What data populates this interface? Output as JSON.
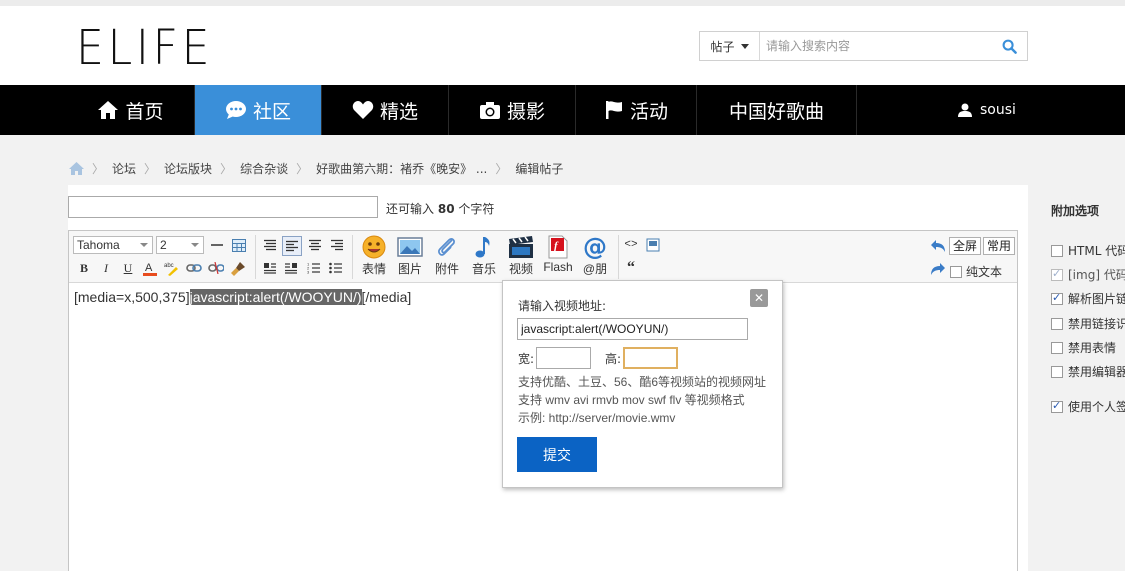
{
  "header": {
    "logo": "ELIFE",
    "search_type": "帖子",
    "search_placeholder": "请输入搜索内容"
  },
  "nav": {
    "items": [
      {
        "label": "首页",
        "icon": "home-icon"
      },
      {
        "label": "社区",
        "icon": "chat-icon",
        "active": true
      },
      {
        "label": "精选",
        "icon": "heart-icon"
      },
      {
        "label": "摄影",
        "icon": "camera-icon"
      },
      {
        "label": "活动",
        "icon": "flag-icon"
      },
      {
        "label": "中国好歌曲",
        "icon": ""
      }
    ],
    "user": "sousi"
  },
  "breadcrumb": [
    "论坛",
    "论坛版块",
    "综合杂谈",
    "好歌曲第六期：褚乔《晚安》 ...",
    "编辑帖子"
  ],
  "title_field": {
    "value": "",
    "hint_prefix": "还可输入",
    "hint_count": "80",
    "hint_suffix": "个字符"
  },
  "toolbar": {
    "font_family": "Tahoma",
    "font_size": "2",
    "bold": "B",
    "italic": "I",
    "underline": "U",
    "quote_glyph": "“",
    "code_glyph": "<>",
    "media": [
      {
        "label": "表情",
        "icon": "smiley-icon"
      },
      {
        "label": "图片",
        "icon": "image-icon"
      },
      {
        "label": "附件",
        "icon": "paperclip-icon"
      },
      {
        "label": "音乐",
        "icon": "music-note-icon"
      },
      {
        "label": "视频",
        "icon": "video-clapper-icon"
      },
      {
        "label": "Flash",
        "icon": "flash-icon"
      },
      {
        "label": "@朋",
        "icon": "at-icon"
      }
    ],
    "fullscreen": "全屏",
    "common": "常用",
    "plain_text": "纯文本"
  },
  "editor": {
    "before": "[media=x,500,375]",
    "selected": "javascript:alert(/WOOYUN/)",
    "after": "[/media]"
  },
  "video_dialog": {
    "title": "请输入视频地址:",
    "url_value": "javascript:alert(/WOOYUN/)",
    "width_label": "宽:",
    "height_label": "高:",
    "width_value": "",
    "height_value": "",
    "notes": [
      "支持优酷、土豆、56、酷6等视频站的视频网址",
      "支持 wmv avi rmvb mov swf flv 等视频格式",
      "示例: http://server/movie.wmv"
    ],
    "submit": "提交"
  },
  "options": {
    "title": "附加选项",
    "items": [
      {
        "label": "HTML 代码",
        "checked": false,
        "disabled": false
      },
      {
        "label": "[img] 代码",
        "checked": true,
        "disabled": true
      },
      {
        "label": "解析图片链",
        "checked": true,
        "disabled": false
      },
      {
        "label": "禁用链接识",
        "checked": false,
        "disabled": false
      },
      {
        "label": "禁用表情",
        "checked": false,
        "disabled": false
      },
      {
        "label": "禁用编辑器",
        "checked": false,
        "disabled": false
      },
      {
        "label": "使用个人签",
        "checked": true,
        "disabled": false
      }
    ]
  }
}
